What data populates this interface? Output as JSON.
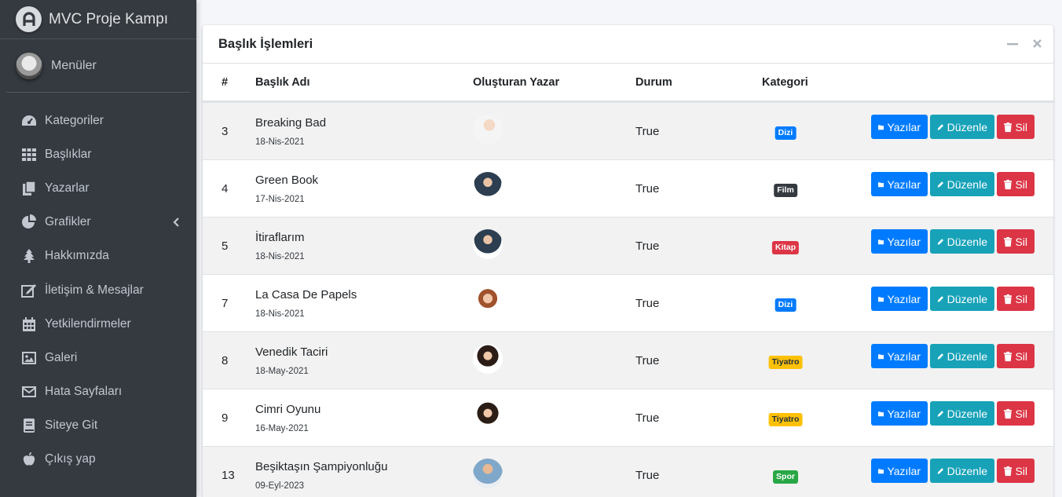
{
  "brand": {
    "title": "MVC Proje Kampı"
  },
  "user": {
    "name": "Menüler"
  },
  "nav": [
    {
      "label": "Kategoriler",
      "icon": "tachometer-icon"
    },
    {
      "label": "Başlıklar",
      "icon": "grid-icon"
    },
    {
      "label": "Yazarlar",
      "icon": "files-icon"
    },
    {
      "label": "Grafikler",
      "icon": "pie-chart-icon"
    },
    {
      "label": "Hakkımızda",
      "icon": "tree-icon"
    },
    {
      "label": "İletişim & Mesajlar",
      "icon": "edit-icon"
    },
    {
      "label": "Yetkilendirmeler",
      "icon": "calendar-icon"
    },
    {
      "label": "Galeri",
      "icon": "image-icon"
    },
    {
      "label": "Hata Sayfaları",
      "icon": "envelope-icon"
    },
    {
      "label": "Siteye Git",
      "icon": "book-icon"
    },
    {
      "label": "Çıkış yap",
      "icon": "apple-icon"
    }
  ],
  "card": {
    "title": "Başlık İşlemleri"
  },
  "table": {
    "headers": {
      "num": "#",
      "title": "Başlık Adı",
      "author": "Oluşturan Yazar",
      "status": "Durum",
      "category": "Kategori"
    },
    "rows": [
      {
        "num": "3",
        "title": "Breaking Bad",
        "date": "18-Nis-2021",
        "status": "True",
        "category": "Dizi",
        "category_color": "#007bff",
        "category_text": "#ffffff"
      },
      {
        "num": "4",
        "title": "Green Book",
        "date": "17-Nis-2021",
        "status": "True",
        "category": "Film",
        "category_color": "#343a40",
        "category_text": "#ffffff"
      },
      {
        "num": "5",
        "title": "İtiraflarım",
        "date": "18-Nis-2021",
        "status": "True",
        "category": "Kitap",
        "category_color": "#dc3545",
        "category_text": "#ffffff"
      },
      {
        "num": "7",
        "title": "La Casa De Papels",
        "date": "18-Nis-2021",
        "status": "True",
        "category": "Dizi",
        "category_color": "#007bff",
        "category_text": "#ffffff"
      },
      {
        "num": "8",
        "title": "Venedik Taciri",
        "date": "18-May-2021",
        "status": "True",
        "category": "Tiyatro",
        "category_color": "#ffc107",
        "category_text": "#1f2d3d"
      },
      {
        "num": "9",
        "title": "Cimri Oyunu",
        "date": "16-May-2021",
        "status": "True",
        "category": "Tiyatro",
        "category_color": "#ffc107",
        "category_text": "#1f2d3d"
      },
      {
        "num": "13",
        "title": "Beşiktaşın Şampiyonluğu",
        "date": "09-Eyl-2023",
        "status": "True",
        "category": "Spor",
        "category_color": "#28a745",
        "category_text": "#ffffff"
      }
    ]
  },
  "buttons": {
    "posts": "Yazılar",
    "edit": "Düzenle",
    "delete": "Sil"
  }
}
